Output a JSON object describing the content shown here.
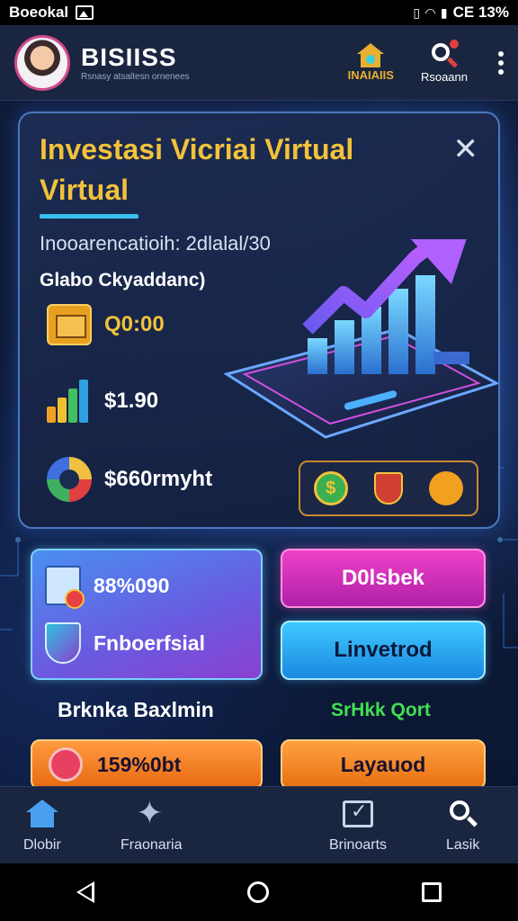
{
  "status_bar": {
    "left_text": "Boeokal",
    "right_text": "CE 13%"
  },
  "app_bar": {
    "brand_title": "BISIISS",
    "brand_subtitle": "Rsnasy atsaltesn ornenees",
    "action_home_label": "INAIAIIS",
    "action_search_label": "Rsoaann"
  },
  "hero": {
    "title": "Investasi Vicriai Virtual Virtual",
    "subtitle": "Inooarencatioih: 2dlalal/30",
    "section_label": "Glabo Ckyaddanc)",
    "rows": [
      {
        "icon": "envelope-icon",
        "value": "Q0:00"
      },
      {
        "icon": "bar-chart-icon",
        "value": "$1.90"
      },
      {
        "icon": "gear-icon",
        "value": "$660rmyht"
      }
    ],
    "actions": [
      "dollar-coin-icon",
      "shield-icon",
      "cog-icon"
    ]
  },
  "cards": {
    "big_card": {
      "row1_label": "88%090",
      "row2_label": "Fnboerfsial"
    },
    "pink_button": "D0lsbek",
    "cyan_button": "Linvetrod",
    "left_label": "Brknka Baxlmin",
    "right_label": "SrHkk Qort",
    "orange_left": "159%0bt",
    "orange_right": "Layauod"
  },
  "bottom_nav": [
    {
      "label": "Dlobir",
      "icon": "home-icon"
    },
    {
      "label": "Fraonaria",
      "icon": "star-icon"
    },
    {
      "label": "Brinoarts",
      "icon": "mail-icon"
    },
    {
      "label": "Lasik",
      "icon": "search-icon"
    }
  ],
  "colors": {
    "accent_yellow": "#f2c23a",
    "accent_cyan": "#3ac0f0",
    "accent_pink": "#f040c8",
    "accent_green": "#40e050"
  }
}
